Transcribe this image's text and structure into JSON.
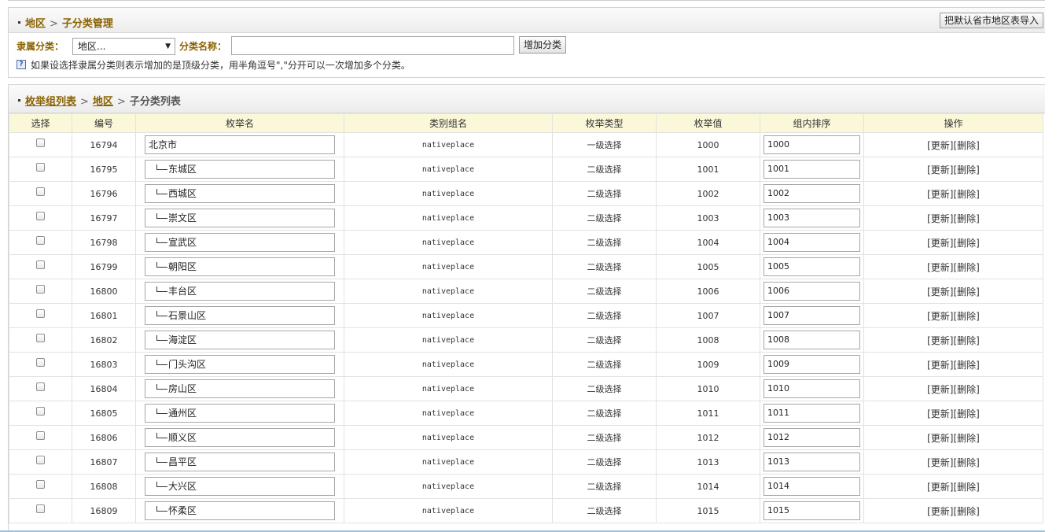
{
  "header": {
    "breadcrumb_root": "地区",
    "breadcrumb_current": "子分类管理",
    "import_button": "把默认省市地区表导入"
  },
  "form": {
    "parent_label": "隶属分类：",
    "parent_selected": "地区...",
    "name_label": "分类名称：",
    "name_value": "",
    "add_button": "增加分类",
    "hint": "如果设选择隶属分类则表示增加的是顶级分类，用半角逗号\",\"分开可以一次增加多个分类。"
  },
  "list": {
    "breadcrumb_1": "枚举组列表",
    "breadcrumb_2": "地区",
    "breadcrumb_3": "子分类列表",
    "columns": [
      "选择",
      "编号",
      "枚举名",
      "类别组名",
      "枚举类型",
      "枚举值",
      "组内排序",
      "操作"
    ],
    "update_label": "[更新]",
    "delete_label": "[删除]",
    "rows": [
      {
        "id": "16794",
        "name": "北京市",
        "child": false,
        "group": "nativeplace",
        "type": "一级选择",
        "value": "1000",
        "order": "1000"
      },
      {
        "id": "16795",
        "name": "东城区",
        "child": true,
        "group": "nativeplace",
        "type": "二级选择",
        "value": "1001",
        "order": "1001"
      },
      {
        "id": "16796",
        "name": "西城区",
        "child": true,
        "group": "nativeplace",
        "type": "二级选择",
        "value": "1002",
        "order": "1002"
      },
      {
        "id": "16797",
        "name": "崇文区",
        "child": true,
        "group": "nativeplace",
        "type": "二级选择",
        "value": "1003",
        "order": "1003"
      },
      {
        "id": "16798",
        "name": "宣武区",
        "child": true,
        "group": "nativeplace",
        "type": "二级选择",
        "value": "1004",
        "order": "1004"
      },
      {
        "id": "16799",
        "name": "朝阳区",
        "child": true,
        "group": "nativeplace",
        "type": "二级选择",
        "value": "1005",
        "order": "1005"
      },
      {
        "id": "16800",
        "name": "丰台区",
        "child": true,
        "group": "nativeplace",
        "type": "二级选择",
        "value": "1006",
        "order": "1006"
      },
      {
        "id": "16801",
        "name": "石景山区",
        "child": true,
        "group": "nativeplace",
        "type": "二级选择",
        "value": "1007",
        "order": "1007"
      },
      {
        "id": "16802",
        "name": "海淀区",
        "child": true,
        "group": "nativeplace",
        "type": "二级选择",
        "value": "1008",
        "order": "1008"
      },
      {
        "id": "16803",
        "name": "门头沟区",
        "child": true,
        "group": "nativeplace",
        "type": "二级选择",
        "value": "1009",
        "order": "1009"
      },
      {
        "id": "16804",
        "name": "房山区",
        "child": true,
        "group": "nativeplace",
        "type": "二级选择",
        "value": "1010",
        "order": "1010"
      },
      {
        "id": "16805",
        "name": "通州区",
        "child": true,
        "group": "nativeplace",
        "type": "二级选择",
        "value": "1011",
        "order": "1011"
      },
      {
        "id": "16806",
        "name": "顺义区",
        "child": true,
        "group": "nativeplace",
        "type": "二级选择",
        "value": "1012",
        "order": "1012"
      },
      {
        "id": "16807",
        "name": "昌平区",
        "child": true,
        "group": "nativeplace",
        "type": "二级选择",
        "value": "1013",
        "order": "1013"
      },
      {
        "id": "16808",
        "name": "大兴区",
        "child": true,
        "group": "nativeplace",
        "type": "二级选择",
        "value": "1014",
        "order": "1014"
      },
      {
        "id": "16809",
        "name": "怀柔区",
        "child": true,
        "group": "nativeplace",
        "type": "二级选择",
        "value": "1015",
        "order": "1015"
      }
    ]
  }
}
